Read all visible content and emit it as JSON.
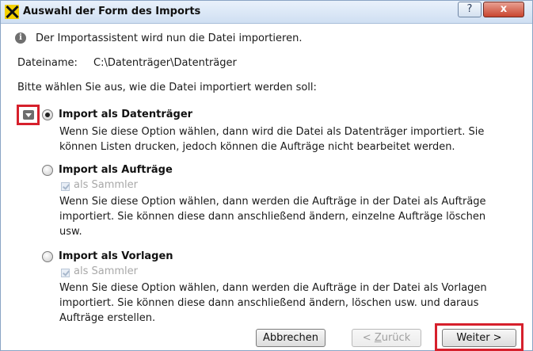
{
  "window": {
    "title": "Auswahl der Form des Imports",
    "help_glyph": "?",
    "close_glyph": "x"
  },
  "info": {
    "icon": "info-icon",
    "text": "Der Importassistent wird nun die Datei importieren."
  },
  "file": {
    "label": "Dateiname:",
    "value": "C:\\Datenträger\\Datenträger"
  },
  "prompt": "Bitte wählen Sie aus, wie die Datei importiert werden soll:",
  "options": [
    {
      "title": "Import als Datenträger",
      "selected": true,
      "description_lines": [
        "Wenn Sie diese Option wählen, dann wird die Datei als Datenträger importiert. Sie",
        "können Listen drucken, jedoch können die Aufträge nicht bearbeitet werden."
      ]
    },
    {
      "title": "Import als Aufträge",
      "selected": false,
      "checkbox_label": "als Sammler",
      "checkbox_checked": true,
      "checkbox_enabled": false,
      "description_lines": [
        "Wenn Sie diese Option wählen, dann werden die Aufträge in der Datei als Aufträge",
        "importiert. Sie können diese dann anschließend ändern, einzelne Aufträge löschen",
        "usw."
      ]
    },
    {
      "title": "Import als Vorlagen",
      "selected": false,
      "checkbox_label": "als Sammler",
      "checkbox_checked": true,
      "checkbox_enabled": false,
      "description_lines": [
        "Wenn Sie diese Option wählen, dann werden die Aufträge in der Datei als Vorlagen",
        "importiert. Sie können diese dann anschließend ändern, löschen usw. und daraus",
        "Aufträge erstellen."
      ]
    }
  ],
  "buttons": {
    "cancel": "Abbrechen",
    "back_prefix": "< ",
    "back_accel": "Z",
    "back_rest": "urück",
    "next": "Weiter >"
  },
  "colors": {
    "highlight": "#d6202c",
    "logo_yellow": "#f3d000",
    "close_red": "#c9452f"
  }
}
